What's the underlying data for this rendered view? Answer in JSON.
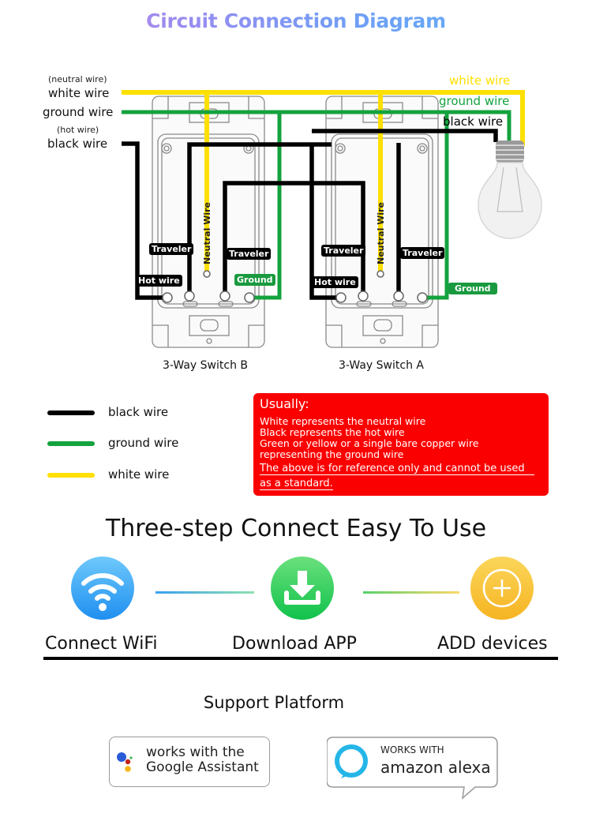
{
  "title": "Circuit Connection Diagram",
  "wire_labels_left": {
    "white_note": "(neutral wire)",
    "white": "white wire",
    "ground": "ground wire",
    "black_note": "(hot wire)",
    "black": "black wire"
  },
  "wire_labels_right": {
    "white": "white wire",
    "ground": "ground wire",
    "black": "black wire"
  },
  "switches": [
    {
      "caption": "3-Way Switch B",
      "traveler_left": "Traveler",
      "traveler_right": "Traveler",
      "hot": "Hot wire",
      "ground": "Ground",
      "neutral": "Neutral Wire"
    },
    {
      "caption": "3-Way Switch A",
      "traveler_left": "Traveler",
      "traveler_right": "Traveler",
      "hot": "Hot wire",
      "ground": "Ground",
      "neutral": "Neutral Wire"
    }
  ],
  "colors": {
    "black_wire": "#000000",
    "ground_wire": "#14a23e",
    "white_wire": "#ffe000",
    "note_bg": "#fb0000"
  },
  "legend": [
    {
      "label": "black wire",
      "color": "#000000"
    },
    {
      "label": "ground wire",
      "color": "#14a23e"
    },
    {
      "label": "white wire",
      "color": "#ffe000"
    }
  ],
  "note": {
    "heading": "Usually:",
    "lines": [
      "White represents the neutral wire",
      "Black represents the hot wire",
      "Green or yellow or a single bare copper wire",
      "representing the ground wire"
    ],
    "disclaimer": [
      "The above is for reference only and cannot be used",
      "as a standard."
    ]
  },
  "steps": {
    "title": "Three-step Connect Easy To Use",
    "items": [
      {
        "label": "Connect WiFi",
        "icon": "wifi-icon"
      },
      {
        "label": "Download APP",
        "icon": "download-icon"
      },
      {
        "label": "ADD devices",
        "icon": "plus-icon"
      }
    ]
  },
  "support": {
    "title": "Support Platform",
    "google": {
      "line1": "works with the",
      "line2": "Google Assistant"
    },
    "alexa": {
      "line1": "WORKS WITH",
      "line2": "amazon alexa"
    }
  }
}
